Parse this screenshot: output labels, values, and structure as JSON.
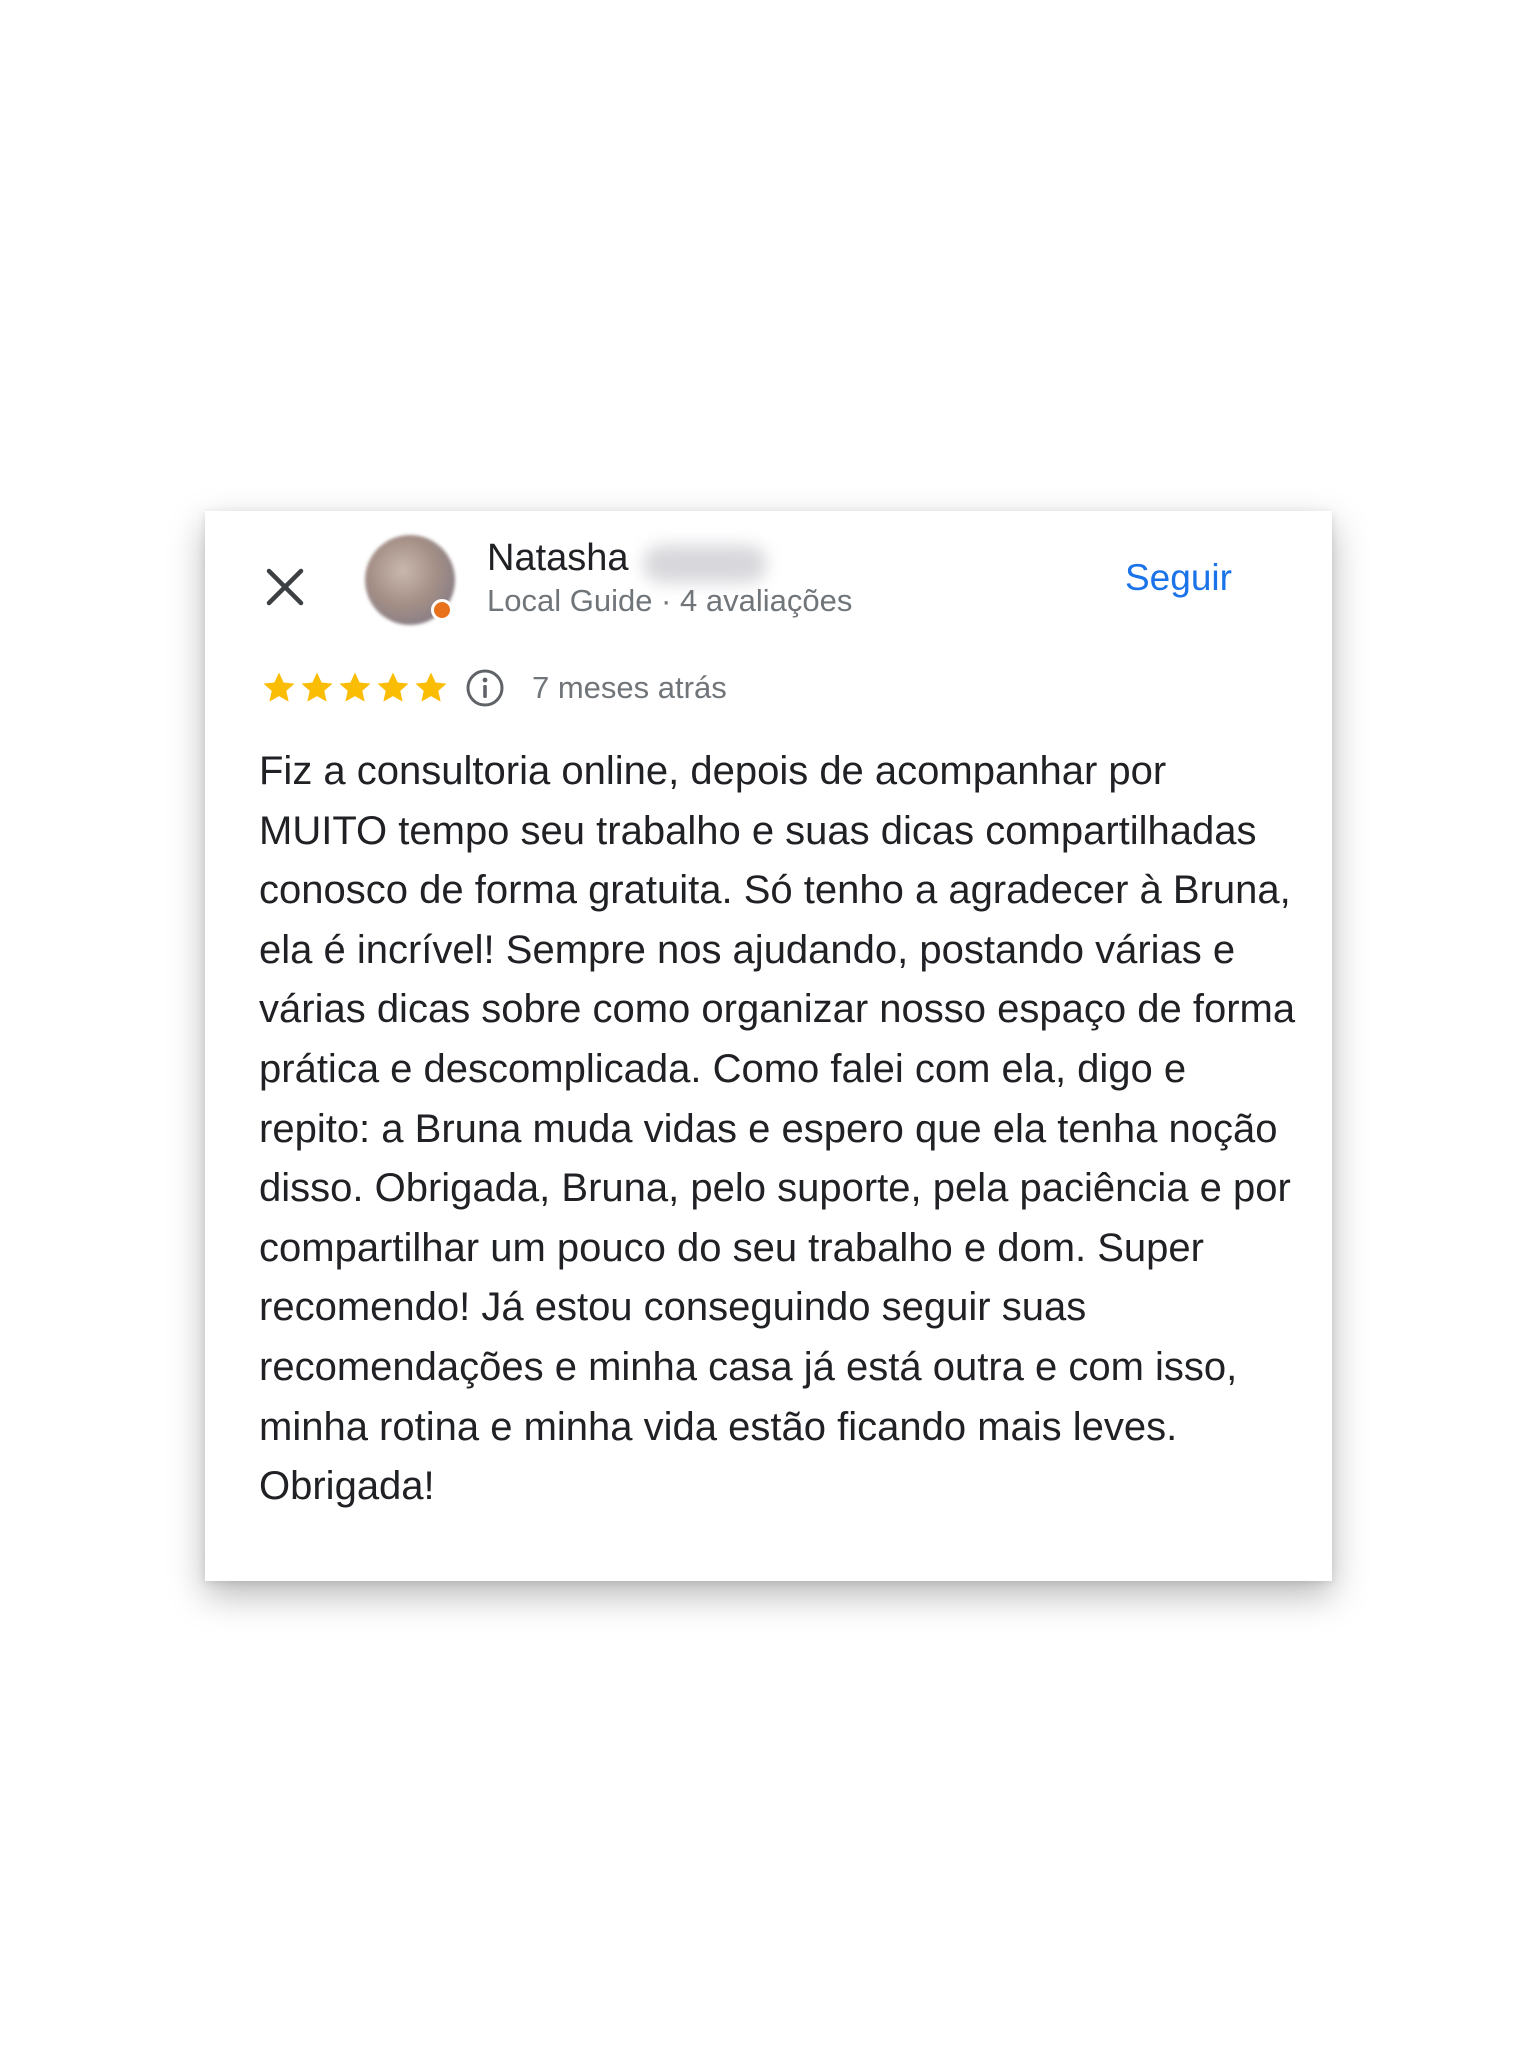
{
  "review": {
    "user_name": "Natasha",
    "user_meta": "Local Guide · 4 avaliações",
    "follow_label": "Seguir",
    "rating": 5,
    "max_rating": 5,
    "time_ago": "7 meses atrás",
    "text": "Fiz a consultoria online, depois de acompanhar por MUITO tempo seu trabalho e suas dicas compartilhadas conosco de forma gratuita. Só tenho a agradecer à Bruna, ela é incrível! Sempre nos ajudando, postando várias e várias dicas sobre como organizar nosso espaço de forma prática e descomplicada. Como falei com ela, digo e repito: a Bruna muda vidas e espero que ela tenha noção disso. Obrigada, Bruna, pelo suporte, pela paciência e por compartilhar um pouco do seu trabalho e dom. Super recomendo! Já estou conseguindo seguir suas recomendações e minha casa já está outra e com isso, minha rotina e minha vida estão ficando mais leves. Obrigada!"
  },
  "icons": {
    "close": "close-icon",
    "info": "info-icon",
    "star": "star-icon"
  },
  "colors": {
    "star": "#fbbc04",
    "follow": "#1a73e8",
    "text": "#202124",
    "secondary_text": "#70757a",
    "local_guide_badge": "#e8711c"
  }
}
